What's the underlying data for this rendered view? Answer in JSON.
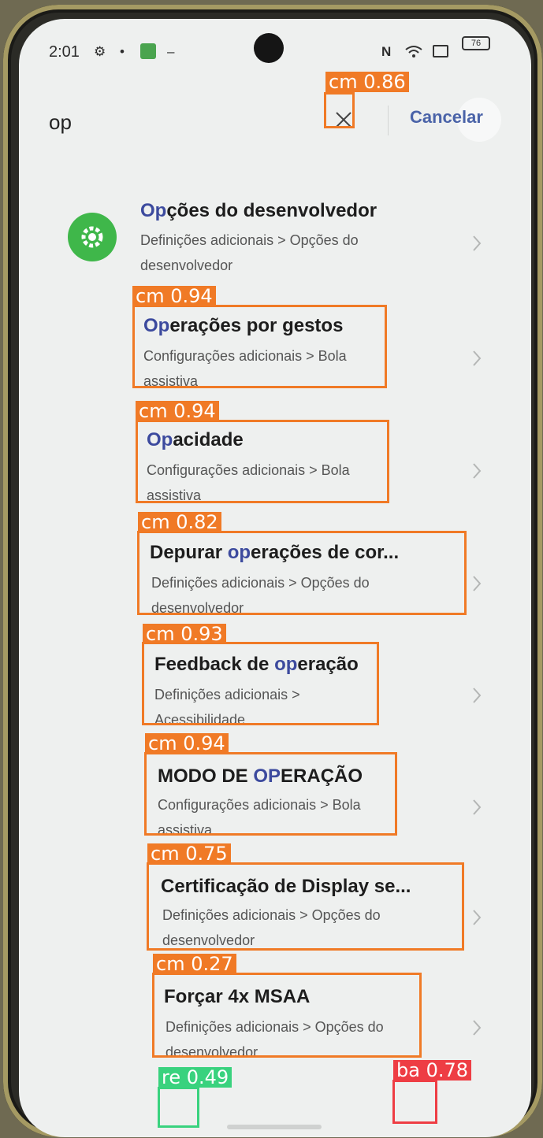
{
  "status_bar": {
    "time": "2:01",
    "battery": "76"
  },
  "search": {
    "query": "op",
    "cancel_label": "Cancelar"
  },
  "results": [
    {
      "title_hl": "Op",
      "title_rest": "ções do desenvolvedor",
      "sub1": "Definições adicionais > Opções do",
      "sub2": "desenvolvedor",
      "icon": "settings-gear-icon"
    },
    {
      "title_hl": "Op",
      "title_rest": "erações por gestos",
      "sub1": "Configurações adicionais > Bola",
      "sub2": "assistiva"
    },
    {
      "title_hl": "Op",
      "title_rest": "acidade",
      "sub1": "Configurações adicionais > Bola",
      "sub2": "assistiva"
    },
    {
      "title_pre": "Depurar ",
      "title_hl": "op",
      "title_rest": "erações de cor...",
      "sub1": "Definições adicionais > Opções do",
      "sub2": "desenvolvedor"
    },
    {
      "title_pre": "Feedback de ",
      "title_hl": "op",
      "title_rest": "eração",
      "sub1": "Definições adicionais >",
      "sub2": "Acessibilidade"
    },
    {
      "title_pre": "MODO DE ",
      "title_hl": "OP",
      "title_rest": "ERAÇÃO",
      "sub1": "Configurações adicionais > Bola",
      "sub2": "assistiva"
    },
    {
      "title_pre": "Certificação de Display se...",
      "sub1": "Definições adicionais > Opções do",
      "sub2": "desenvolvedor"
    },
    {
      "title_pre": "Forçar 4x MSAA",
      "sub1": "Definições adicionais > Opções do",
      "sub2": "desenvolvedor"
    }
  ],
  "detections": [
    {
      "label": "cm 0.86",
      "color": "#f07a26"
    },
    {
      "label": "cm 0.94",
      "color": "#f07a26"
    },
    {
      "label": "cm 0.94",
      "color": "#f07a26"
    },
    {
      "label": "cm 0.82",
      "color": "#f07a26"
    },
    {
      "label": "cm 0.93",
      "color": "#f07a26"
    },
    {
      "label": "cm 0.94",
      "color": "#f07a26"
    },
    {
      "label": "cm 0.75",
      "color": "#f07a26"
    },
    {
      "label": "cm 0.27",
      "color": "#f07a26"
    },
    {
      "label": "re 0.49",
      "color": "#39d27e"
    },
    {
      "label": "ba 0.78",
      "color": "#ee3d44"
    }
  ],
  "colors": {
    "accent": "#4a63a8",
    "highlight": "#3c4a9e",
    "icon_green": "#3fb74a",
    "background": "#eef0ef"
  }
}
